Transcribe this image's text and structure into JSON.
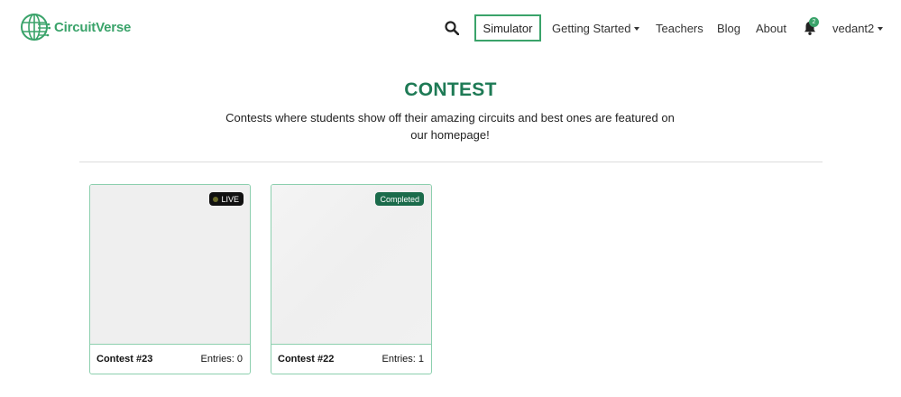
{
  "navbar": {
    "brand_name": "CircuitVerse",
    "simulator_label": "Simulator",
    "getting_started_label": "Getting Started",
    "teachers_label": "Teachers",
    "blog_label": "Blog",
    "about_label": "About",
    "notification_count": "2",
    "user_label": "vedant2",
    "icons": [
      "logo-icon",
      "search-icon",
      "bell-icon",
      "caret-down-icon"
    ]
  },
  "header": {
    "title": "CONTEST",
    "description": "Contests where students show off their amazing circuits and best ones are featured on our homepage!"
  },
  "contests": [
    {
      "title": "Contest #23",
      "entries": "Entries: 0",
      "status": "LIVE"
    },
    {
      "title": "Contest #22",
      "entries": "Entries: 1",
      "status": "Completed"
    }
  ],
  "colors": {
    "brand_green": "#3aa36a",
    "title_green": "#1e7a55",
    "card_border": "#8ccfae",
    "live_badge": "#111111",
    "completed_badge": "#1b6b4b"
  }
}
